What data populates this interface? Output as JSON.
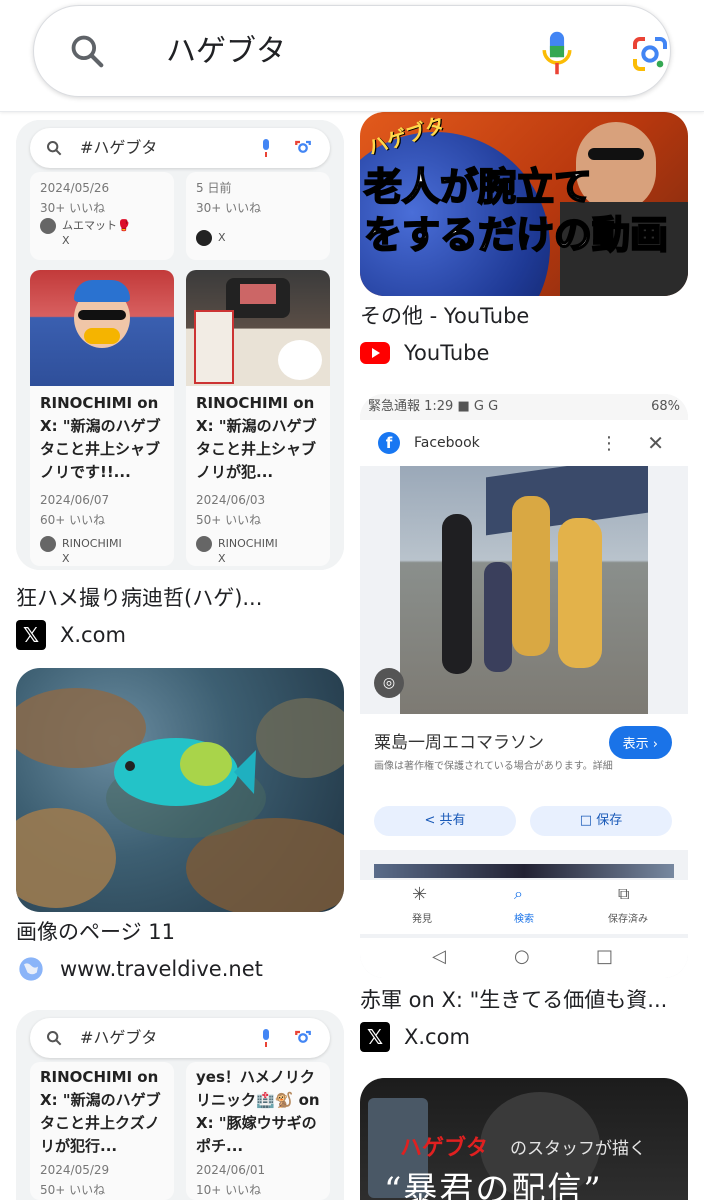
{
  "search": {
    "query": "ハゲブタ"
  },
  "left": [
    {
      "title": "狂ハメ撮り病迪哲(ハゲ)...",
      "source": "X.com",
      "favicon": "x-logo-icon",
      "mini": {
        "query": "#ハゲブタ",
        "top_cells": [
          {
            "date": "2024/05/26",
            "likes": "30+ いいね",
            "author": "ムエマット🥊",
            "sub": "X"
          },
          {
            "date": "5 日前",
            "likes": "30+ いいね",
            "author": "X",
            "sub": ""
          }
        ],
        "cells": [
          {
            "text": "RINOCHIMI on X: \"新潟のハゲブタこと井上シャブノリです!!...",
            "date": "2024/06/07",
            "likes": "60+ いいね",
            "author": "RINOCHIMI",
            "sub": "X"
          },
          {
            "text": "RINOCHIMI on X: \"新潟のハゲブタこと井上シャブノリが犯...",
            "date": "2024/06/03",
            "likes": "50+ いいね",
            "author": "RINOCHIMI",
            "sub": "X"
          }
        ]
      }
    },
    {
      "title": "画像のページ 11",
      "source": "www.traveldive.net",
      "favicon": "globe-icon"
    },
    {
      "mini": {
        "query": "#ハゲブタ",
        "cells": [
          {
            "text": "RINOCHIMI on X: \"新潟のハゲブタこと井上クズノリが犯行...",
            "date": "2024/05/29",
            "likes": "50+ いいね"
          },
          {
            "text": "yes！ハメノリクリニック🏥🐒 on X: \"豚嫁ウサギのポチ...",
            "date": "2024/06/01",
            "likes": "10+ いいね"
          }
        ]
      }
    }
  ],
  "right": [
    {
      "overlay_small": "ハゲブタ",
      "overlay_line1": "老人が腕立て",
      "overlay_line2": "をするだけの動画",
      "title": "その他 - YouTube",
      "source": "YouTube",
      "favicon": "youtube-icon"
    },
    {
      "title": "赤軍 on X: \"生きてる価値も資...",
      "source": "X.com",
      "favicon": "x-logo-icon",
      "fb": {
        "status": "緊急通報 1:29 ■ G G",
        "battery": "68%",
        "app": "Facebook",
        "caption": "粟島一周エコマラソン",
        "show": "表示 ›",
        "notice": "画像は著作権で保護されている場合があります。詳細",
        "share": "< 共有",
        "save": "□ 保存",
        "nav": [
          "発見",
          "検索",
          "保存済み"
        ]
      }
    },
    {
      "overlay_red": "ハゲブタ",
      "overlay_rest": "のスタッフが描く",
      "overlay_big": "“暴君の配信”"
    }
  ],
  "colors": {
    "accent_blue": "#1a73e8",
    "youtube_red": "#ff0000",
    "border": "#dadce0"
  }
}
